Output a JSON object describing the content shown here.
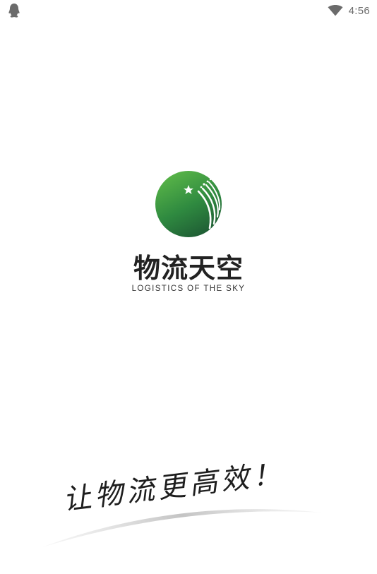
{
  "status_bar": {
    "time": "4:56",
    "left_icon": "qq-penguin-icon",
    "wifi_icon": "wifi-icon"
  },
  "splash": {
    "brand_name": "物流天空",
    "brand_tagline": "LOGISTICS OF THE SKY",
    "slogan": "让物流更高效！"
  },
  "colors": {
    "logo_green_light": "#5cb848",
    "logo_green_dark": "#1e5b34",
    "text_dark": "#222222",
    "status_gray": "#6b6b6b"
  }
}
